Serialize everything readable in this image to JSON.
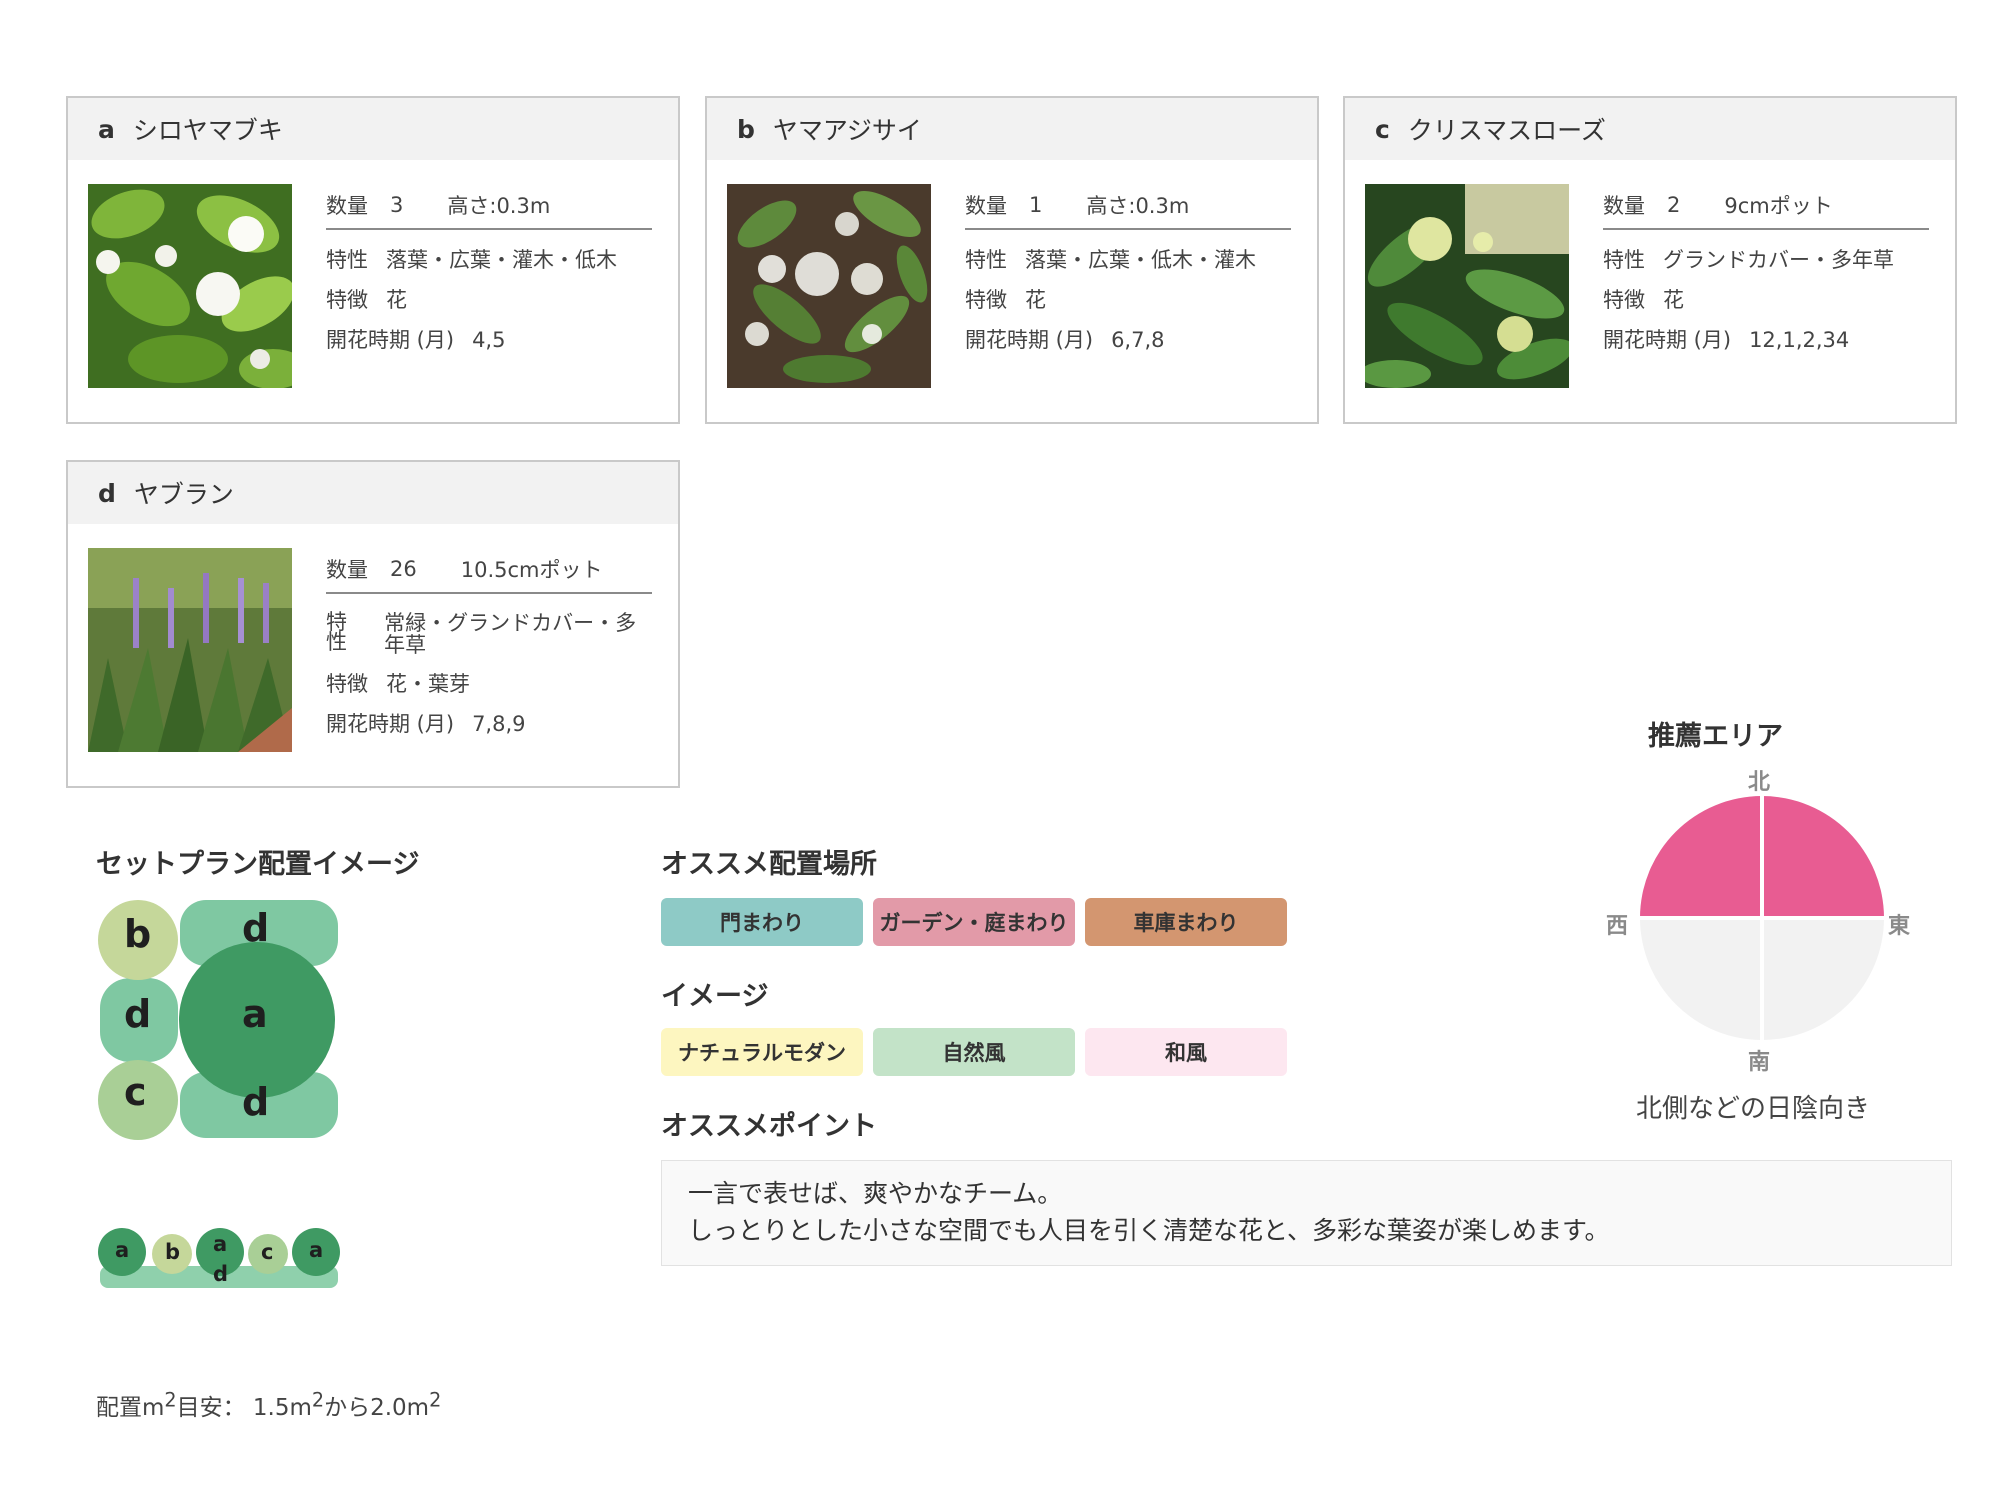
{
  "plants": [
    {
      "letter": "a",
      "name": "シロヤマブキ",
      "qty_label": "数量",
      "qty": "3",
      "size": "高さ:0.3m",
      "trait_label": "特性",
      "trait": "落葉・広葉・灌木・低木",
      "feature_label": "特徴",
      "feature": "花",
      "bloom_label": "開花時期 (月)",
      "bloom": "4,5"
    },
    {
      "letter": "b",
      "name": "ヤマアジサイ",
      "qty_label": "数量",
      "qty": "1",
      "size": "高さ:0.3m",
      "trait_label": "特性",
      "trait": "落葉・広葉・低木・灌木",
      "feature_label": "特徴",
      "feature": "花",
      "bloom_label": "開花時期 (月)",
      "bloom": "6,7,8"
    },
    {
      "letter": "c",
      "name": "クリスマスローズ",
      "qty_label": "数量",
      "qty": "2",
      "size": "9cmポット",
      "trait_label": "特性",
      "trait": "グランドカバー・多年草",
      "feature_label": "特徴",
      "feature": "花",
      "bloom_label": "開花時期 (月)",
      "bloom": "12,1,2,34"
    },
    {
      "letter": "d",
      "name": "ヤブラン",
      "qty_label": "数量",
      "qty": "26",
      "size": "10.5cmポット",
      "trait_label": "特性",
      "trait": "常緑・グランドカバー・多年草",
      "feature_label": "特徴",
      "feature": "花・葉芽",
      "bloom_label": "開花時期 (月)",
      "bloom": "7,8,9"
    }
  ],
  "layout_plan": {
    "title": "セットプラン配置イメージ",
    "grid_labels": [
      "b",
      "d",
      "d",
      "a",
      "c",
      "d"
    ],
    "row_labels": [
      "a",
      "b",
      "a",
      "d",
      "c",
      "a"
    ],
    "area_prefix": "配置m",
    "area_sup1": "2",
    "area_mid": "目安：  1.5m",
    "area_sup2": "2",
    "area_mid2": "から2.0m",
    "area_sup3": "2"
  },
  "placement": {
    "title": "オススメ配置場所",
    "tags": [
      {
        "label": "門まわり",
        "color": "#8ecac6"
      },
      {
        "label": "ガーデン・庭まわり",
        "color": "#e29aa8"
      },
      {
        "label": "車庫まわり",
        "color": "#d39670"
      }
    ]
  },
  "image_section": {
    "title": "イメージ",
    "tags": [
      {
        "label": "ナチュラルモダン",
        "color": "#fdf6c0"
      },
      {
        "label": "自然風",
        "color": "#c3e3c8"
      },
      {
        "label": "和風",
        "color": "#fde7f0"
      }
    ]
  },
  "point": {
    "title": "オススメポイント",
    "line1": "一言で表せば、爽やかなチーム。",
    "line2": "しっとりとした小さな空間でも人目を引く清楚な花と、多彩な葉姿が楽しめます。"
  },
  "area": {
    "title": "推薦エリア",
    "north": "北",
    "south": "南",
    "east": "東",
    "west": "西",
    "caption": "北側などの日陰向き",
    "highlight_color": "#e85c92",
    "base_color": "#f2f2f2"
  }
}
